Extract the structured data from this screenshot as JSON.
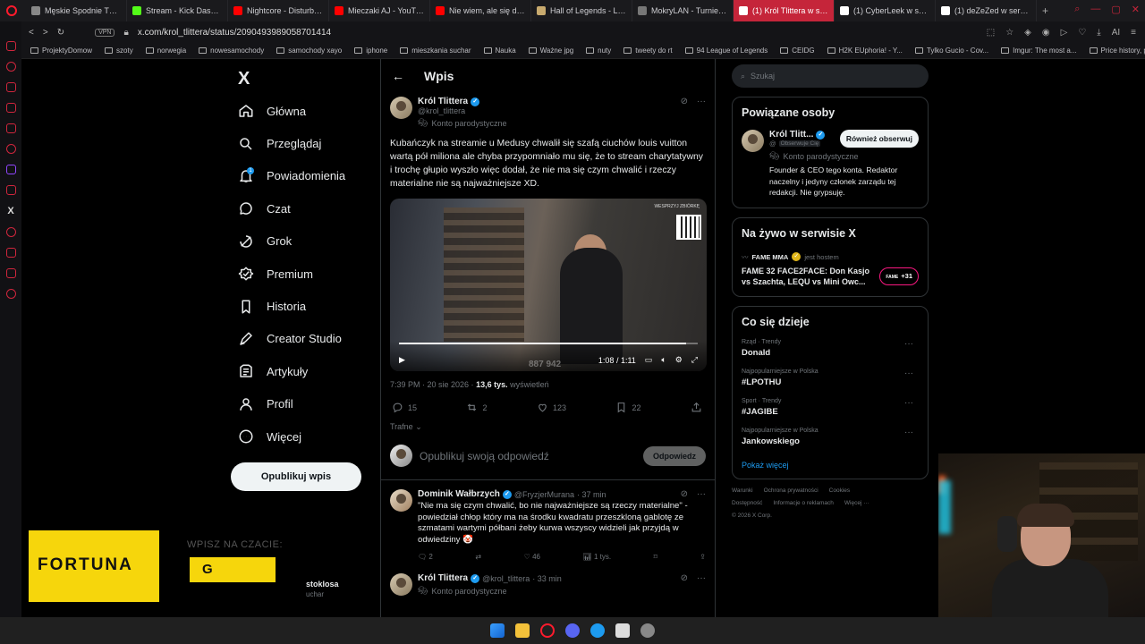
{
  "browser": {
    "tabs": [
      {
        "label": "Męskie Spodnie THE NO",
        "color": "#888888"
      },
      {
        "label": "Stream - Kick Dashboard",
        "color": "#53fc18"
      },
      {
        "label": "Nightcore - Disturbia (Si",
        "color": "#ff0000"
      },
      {
        "label": "Mieczaki AJ - YouTube",
        "color": "#ff0000"
      },
      {
        "label": "Nie wiem, ale się dowiem",
        "color": "#ff0000"
      },
      {
        "label": "Hall of Legends - League",
        "color": "#c8aa6e"
      },
      {
        "label": "MokryLAN - Turniej CS2",
        "color": "#777777"
      },
      {
        "label": "(1) Król Tlittera w serwisie",
        "color": "#ffffff"
      },
      {
        "label": "(1) CyberLeek w serwisie",
        "color": "#ffffff"
      },
      {
        "label": "(1) deZeZed w serwisie X",
        "color": "#ffffff"
      }
    ],
    "active_tab": 7,
    "vpn_label": "VPN",
    "url": "x.com/krol_tlittera/status/2090493989058701414",
    "bookmarks": [
      "ProjektyDomow",
      "szoty",
      "norwegia",
      "nowesamochody",
      "samochody xayo",
      "iphone",
      "mieszkania suchar",
      "Nauka",
      "Ważne jpg",
      "nuty",
      "tweety do rt",
      "94 League of Legends",
      "CEIDG",
      "H2K EUphoria! - Y...",
      "Tylko Gucio - Cov...",
      "Imgur: The most a...",
      "Price history, price..."
    ]
  },
  "nav": {
    "logo": "X",
    "items": [
      "Główna",
      "Przeglądaj",
      "Powiadomienia",
      "Czat",
      "Grok",
      "Premium",
      "Historia",
      "Creator Studio",
      "Artykuły",
      "Profil",
      "Więcej"
    ],
    "notification_badge": "1",
    "post_button": "Opublikuj wpis"
  },
  "main": {
    "title": "Wpis",
    "tweet": {
      "name": "Król Tlittera",
      "handle": "@krol_tlittera",
      "parody_label": "Konto parodystyczne",
      "text": "Kubańczyk na streamie u Medusy chwalił się szafą ciuchów louis vuitton wartą pół miliona ale chyba przypomniało mu się, że to stream charytatywny i trochę głupio wyszło więc dodał, że nie ma się czym chwalić i rzeczy materialne nie są najważniejsze XD.",
      "video": {
        "time": "1:08 / 1:11",
        "progress": 0.96,
        "overlay_number": "887 942",
        "qr_label": "WESPRZYJ ZBIÓRKĘ"
      },
      "timestamp": "7:39 PM · 20 sie 2026 · ",
      "views_count": "13,6 tys.",
      "views_label": " wyświetleń",
      "replies": "15",
      "reposts": "2",
      "likes": "123",
      "bookmarks": "22"
    },
    "sort_label": "Trafne",
    "reply_placeholder": "Opublikuj swoją odpowiedź",
    "reply_button": "Odpowiedz",
    "replies": [
      {
        "name": "Dominik Wałbrzych",
        "handle": "@FryzjerMurana",
        "time": "· 37 min",
        "text": "\"Nie ma się czym chwalić, bo nie najważniejsze są rzeczy materialne\" - powiedział chłop który ma na środku kwadratu przeszkloną gablotę ze szmatami wartymi półbani żeby kurwa wszyscy widzieli jak przyjdą w odwiedziny 🤡",
        "replies": "2",
        "reposts": "",
        "likes": "46",
        "views": "1 tys."
      },
      {
        "name": "Król Tlittera",
        "handle": "@krol_tlittera",
        "time": "· 33 min",
        "parody_label": "Konto parodystyczne"
      }
    ]
  },
  "right": {
    "search_placeholder": "Szukaj",
    "related_title": "Powiązane osoby",
    "related": {
      "name": "Król Tlitt...",
      "handle": "@",
      "follows_you": "Obserwuje Cię",
      "follow_button": "Również obserwuj",
      "parody_label": "Konto parodystyczne",
      "bio": "Founder & CEO tego konta. Redaktor naczelny i jedyny członek zarządu tej redakcji. Nie grypsuję."
    },
    "live_title": "Na żywo w serwisie X",
    "live": {
      "host": "FAME MMA",
      "host_suffix": "jest hostem",
      "title": "FAME 32 FACE2FACE: Don Kasjo vs Szachta, LEQU vs Mini Owc...",
      "badge": "+31"
    },
    "trends_title": "Co się dzieje",
    "trends": [
      {
        "category": "Rząd · Trendy",
        "name": "Donald"
      },
      {
        "category": "Najpopularniejsze w Polska",
        "name": "#LPOTHU"
      },
      {
        "category": "Sport · Trendy",
        "name": "#JAGIBE"
      },
      {
        "category": "Najpopularniejsze w Polska",
        "name": "Jankowskiego"
      }
    ],
    "show_more": "Pokaż więcej",
    "footer": [
      "Warunki",
      "Ochrona prywatności",
      "Cookies",
      "Dostępność",
      "Informacje o reklamach",
      "Więcej ···",
      "© 2026 X Corp."
    ]
  },
  "overlay": {
    "fortuna_logo": "FORTUNA",
    "chat_prompt": "WPISZ NA CZACIE:",
    "chat_code": "G",
    "side_name": "stoklosa",
    "side_sub": "uchar"
  },
  "colors": {
    "accent": "#1d9bf0",
    "opera_red": "#ff1b2d",
    "fortuna_yellow": "#f6d60c"
  }
}
